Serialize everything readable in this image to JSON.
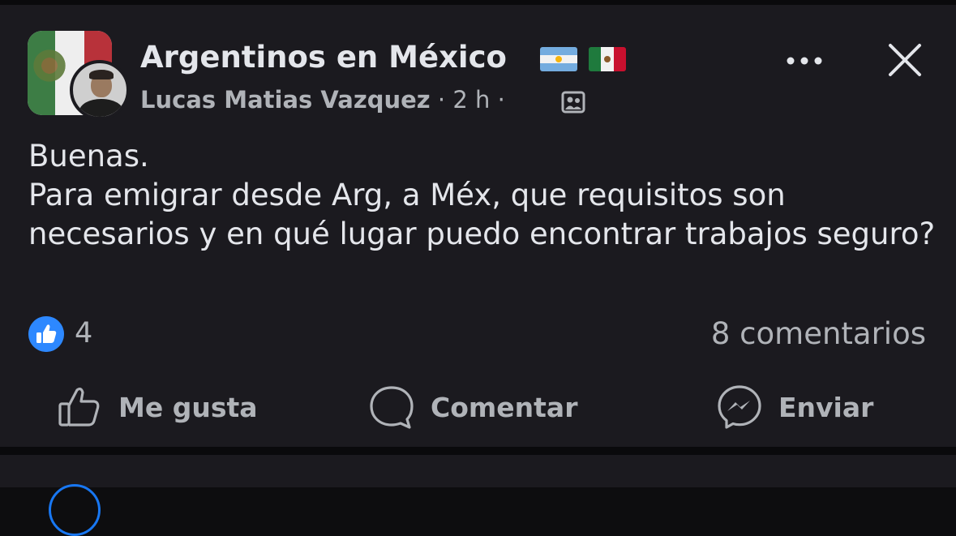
{
  "post": {
    "group_name": "Argentinos en México",
    "group_flags": [
      "flag-argentina-icon",
      "flag-mexico-icon"
    ],
    "author": "Lucas Matias Vazquez",
    "separator": " · ",
    "time": "2 h",
    "audience_icon": "group-members-icon",
    "body_lines": [
      "Buenas.",
      "Para emigrar desde Arg, a Méx, que requisitos son necesarios y en qué lugar puedo encontrar trabajos seguro?"
    ],
    "reactions": {
      "icon": "like-reaction-icon",
      "count": "4"
    },
    "comments_text": "8 comentarios",
    "actions": {
      "like": "Me gusta",
      "comment": "Comentar",
      "send": "Enviar"
    }
  },
  "colors": {
    "background": "#1b1a1f",
    "text_primary": "#e4e6eb",
    "text_secondary": "#b0b3b8",
    "accent_blue": "#2d88ff"
  }
}
